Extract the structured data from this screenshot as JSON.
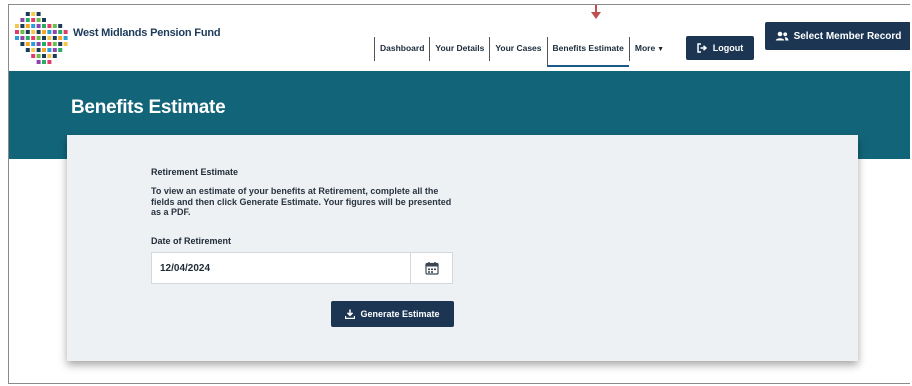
{
  "brand": {
    "name": "West Midlands Pension Fund"
  },
  "nav": {
    "items": [
      {
        "label": "Dashboard"
      },
      {
        "label": "Your Details"
      },
      {
        "label": "Your Cases"
      },
      {
        "label": "Benefits Estimate"
      },
      {
        "label": "More"
      }
    ],
    "active_index": 3,
    "logout_label": "Logout",
    "select_member_label": "Select Member Record"
  },
  "page": {
    "title": "Benefits Estimate"
  },
  "estimate": {
    "heading": "Retirement Estimate",
    "description": "To view an estimate of your benefits at Retirement, complete all the fields and then click Generate Estimate. Your figures will be presented as a PDF.",
    "date_label": "Date of Retirement",
    "date_value": "12/04/2024",
    "generate_label": "Generate Estimate"
  },
  "colors": {
    "banner": "#126579",
    "button": "#1b3552",
    "annotation_arrow": "#c0504d"
  },
  "icons": {
    "logo": "mosaic-dots-logo",
    "logout": "sign-out-icon",
    "select_member": "users-icon",
    "calendar": "calendar-icon",
    "generate": "download-icon",
    "more": "caret-down-icon"
  }
}
